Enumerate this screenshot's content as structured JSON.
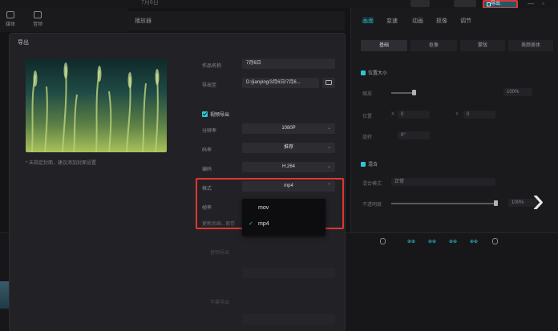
{
  "app": {
    "window_title": "7月6日",
    "export_button": "导出"
  },
  "left_rail": {
    "items": [
      "媒体",
      "音频"
    ]
  },
  "center_strip": {
    "label": "播放器"
  },
  "right_panel": {
    "tabs": [
      "画面",
      "变速",
      "动画",
      "抠像",
      "调节"
    ],
    "segments": [
      "基础",
      "抠像",
      "蒙版",
      "美颜美体"
    ],
    "position_size": "位置大小",
    "scale_label": "缩放",
    "scale_value": "100%",
    "position_label": "位置",
    "position_x_label": "X",
    "position_x_value": "0",
    "position_y_label": "Y",
    "position_y_value": "0",
    "rotate_label": "旋转",
    "rotate_value": "0°",
    "blend": "混合",
    "blend_mode_label": "混合模式",
    "blend_mode_value": "正常",
    "opacity_label": "不透明度",
    "opacity_value": "100%"
  },
  "timeline": {
    "tools": [
      "⊕⊕",
      "⊕⊕",
      "⊕⊕",
      "⊕⊕"
    ]
  },
  "export_dialog": {
    "title": "导出",
    "cover_hint": "* 未指定封面，建议添加封面设置",
    "name_label": "作品名称",
    "name_value": "7月6日",
    "path_label": "导出至",
    "path_value": "D:/jianying/3月6日/7月6...",
    "video_export_label": "视频导出",
    "resolution_label": "分辨率",
    "resolution_value": "1080P",
    "bitrate_label": "码率",
    "bitrate_value": "推荐",
    "codec_label": "编码",
    "codec_value": "H.264",
    "format_label": "格式",
    "format_value": "mp4",
    "framerate_label": "帧率",
    "hidden_hint": "更新后画...保存",
    "format_options": [
      "mov",
      "mp4"
    ],
    "format_selected": "mp4",
    "audio_label": "音频导出",
    "subtitle_label": "字幕导出"
  },
  "colors": {
    "accent": "#2fc7d6",
    "highlight": "#e3342f",
    "dialog_bg": "#222226"
  }
}
